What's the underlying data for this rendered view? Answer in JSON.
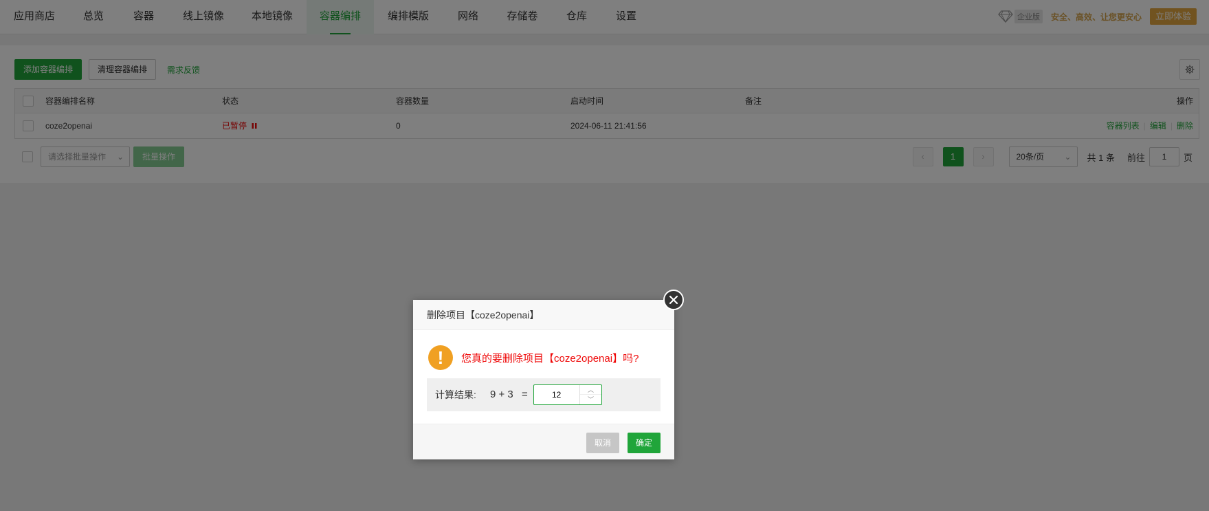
{
  "nav": {
    "tabs": [
      "应用商店",
      "总览",
      "容器",
      "线上镜像",
      "本地镜像",
      "容器编排",
      "编排模版",
      "网络",
      "存储卷",
      "仓库",
      "设置"
    ],
    "active_tab": "容器编排",
    "enterprise_tag": "企业版",
    "promo_text": "安全、高效、让您更安心",
    "try_button": "立即体验"
  },
  "toolbar": {
    "add_label": "添加容器编排",
    "clean_label": "清理容器编排",
    "feedback_label": "需求反馈"
  },
  "table": {
    "headers": [
      "容器编排名称",
      "状态",
      "容器数量",
      "启动时间",
      "备注",
      "操作"
    ],
    "rows": [
      {
        "name": "coze2openai",
        "status": "已暂停",
        "count": "0",
        "start_time": "2024-06-11 21:41:56",
        "note": "",
        "actions": [
          "容器列表",
          "编辑",
          "删除"
        ]
      }
    ]
  },
  "batch": {
    "placeholder": "请选择批量操作",
    "button": "批量操作"
  },
  "pager": {
    "current": "1",
    "per_page": "20条/页",
    "total": "共 1 条",
    "goto_label": "前往",
    "goto_value": "1",
    "page_suffix": "页"
  },
  "dialog": {
    "title": "删除项目【coze2openai】",
    "message": "您真的要删除项目【coze2openai】吗?",
    "calc_label": "计算结果:",
    "calc_expr": "9 + 3",
    "calc_eq": "=",
    "calc_value": "12",
    "cancel": "取消",
    "confirm": "确定"
  },
  "colors": {
    "accent": "#20a53a",
    "danger": "#ef0808",
    "warning": "#f0a022",
    "promo": "#e2a640"
  }
}
